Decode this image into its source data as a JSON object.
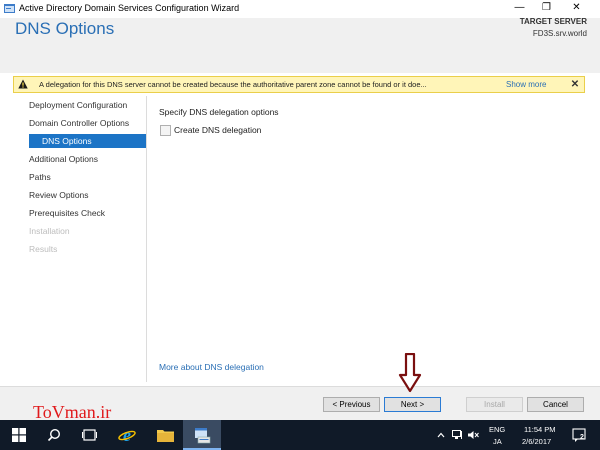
{
  "window": {
    "title": "Active Directory Domain Services Configuration Wizard",
    "controls": {
      "minimize": "—",
      "maximize": "❐",
      "close": "✕"
    }
  },
  "header": {
    "page_title": "DNS Options",
    "target_label": "TARGET SERVER",
    "target_value": "FD3S.srv.world"
  },
  "warning": {
    "text": "A delegation for this DNS server cannot be created because the authoritative parent zone cannot be found or it doe...",
    "show_more": "Show more",
    "close": "✕"
  },
  "nav": {
    "items": [
      {
        "label": "Deployment Configuration",
        "state": "normal"
      },
      {
        "label": "Domain Controller Options",
        "state": "normal"
      },
      {
        "label": "DNS Options",
        "state": "selected"
      },
      {
        "label": "Additional Options",
        "state": "normal"
      },
      {
        "label": "Paths",
        "state": "normal"
      },
      {
        "label": "Review Options",
        "state": "normal"
      },
      {
        "label": "Prerequisites Check",
        "state": "normal"
      },
      {
        "label": "Installation",
        "state": "disabled"
      },
      {
        "label": "Results",
        "state": "disabled"
      }
    ]
  },
  "content": {
    "heading": "Specify DNS delegation options",
    "checkbox_label": "Create DNS delegation",
    "checkbox_checked": false,
    "more_link": "More about DNS delegation"
  },
  "buttons": {
    "previous": "< Previous",
    "next": "Next >",
    "install": "Install",
    "cancel": "Cancel"
  },
  "watermark": "ToVman.ir",
  "taskbar": {
    "lang_top": "ENG",
    "lang_bottom": "JA",
    "time": "11:54 PM",
    "date": "2/6/2017",
    "notification_count": "2"
  },
  "colors": {
    "accent": "#1c74c6",
    "title_blue": "#2a6fb5",
    "warning_bg": "#fff5b8",
    "taskbar": "#101a28",
    "watermark": "#e0191b",
    "arrow": "#7a0f0f"
  }
}
